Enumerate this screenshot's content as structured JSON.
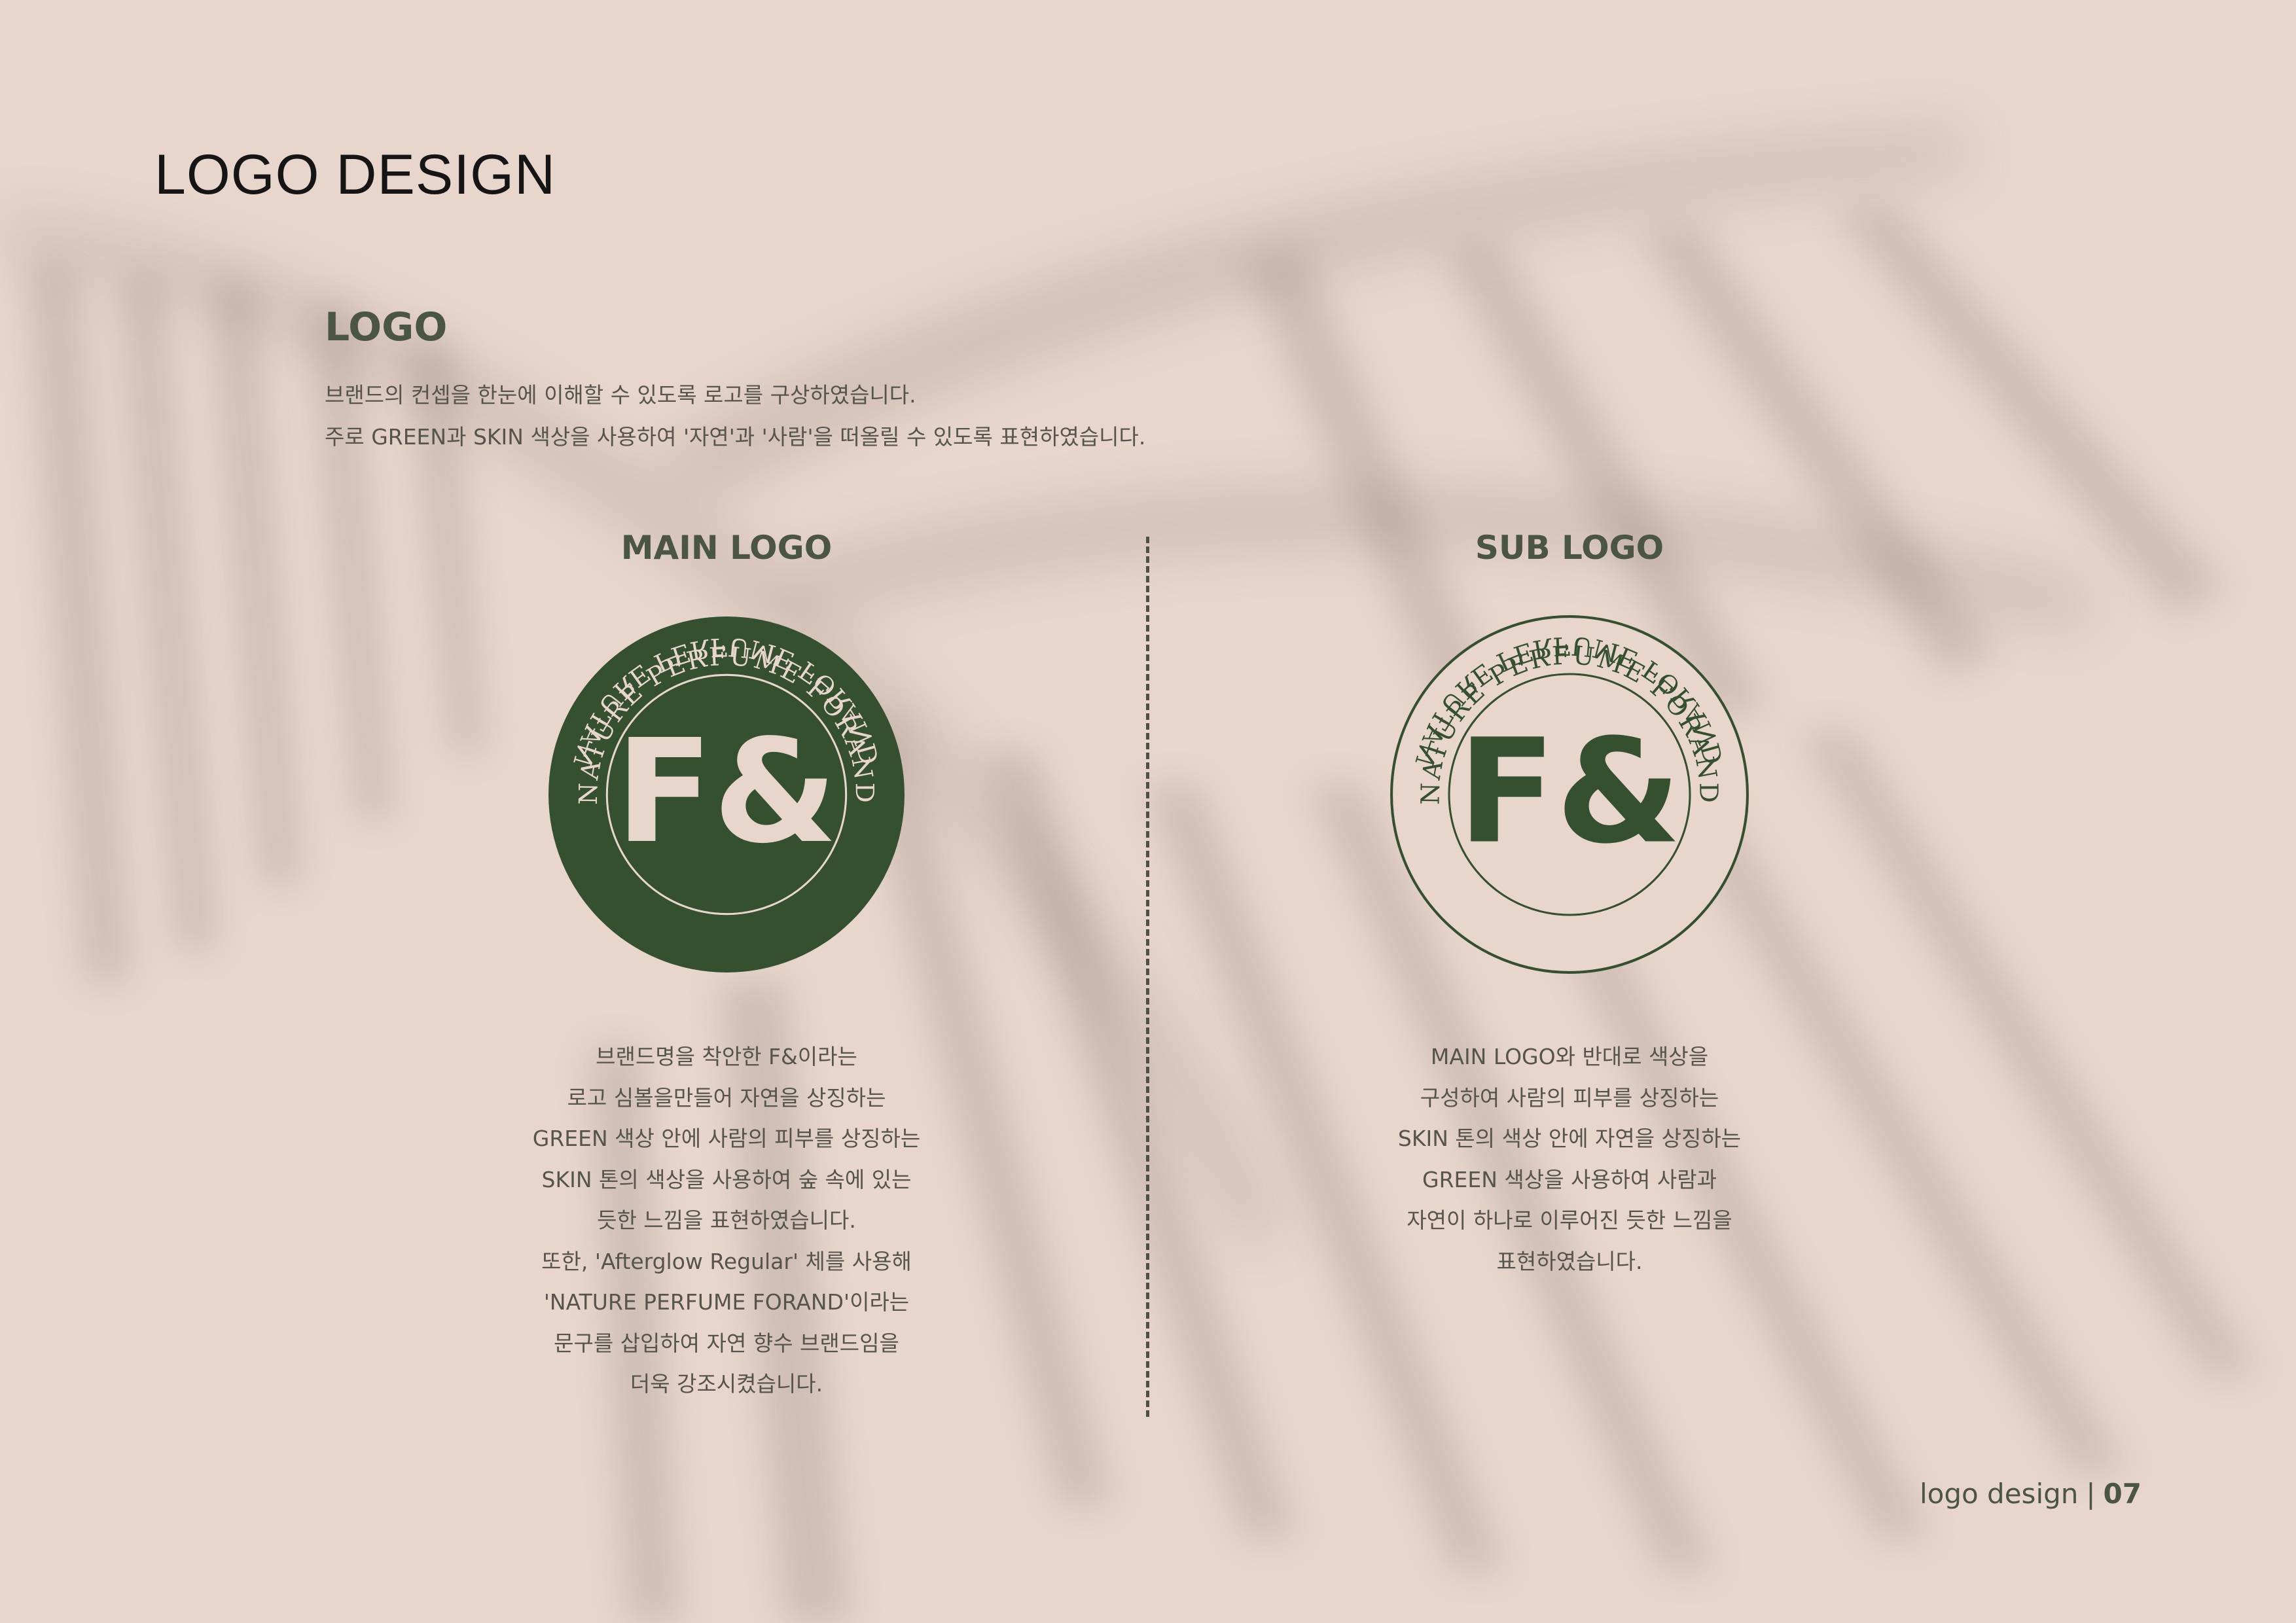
{
  "header": {
    "title": "LOGO DESIGN"
  },
  "logo_section": {
    "title": "LOGO",
    "intro_lines": [
      "브랜드의 컨셉을 한눈에 이해할 수 있도록 로고를 구상하였습니다.",
      "주로 GREEN과 SKIN 색상을 사용하여 '자연'과 '사람'을 떠올릴 수 있도록 표현하였습니다."
    ]
  },
  "main_logo": {
    "title": "MAIN LOGO",
    "mark_text": "F&",
    "ring_text_top": "NATURE PERFUME FORAND",
    "ring_text_bottom": "NATURE PERFUME FORAND",
    "description_lines": [
      "브랜드명을 착안한 F&이라는",
      "로고 심볼을만들어 자연을 상징하는",
      "GREEN 색상 안에 사람의 피부를 상징하는",
      "SKIN 톤의 색상을 사용하여 숲 속에 있는",
      "듯한 느낌을 표현하였습니다.",
      "또한, 'Afterglow Regular' 체를 사용해",
      "'NATURE PERFUME FORAND'이라는",
      "문구를 삽입하여 자연 향수 브랜드임을",
      "더욱 강조시켰습니다."
    ]
  },
  "sub_logo": {
    "title": "SUB LOGO",
    "mark_text": "F&",
    "ring_text_top": "NATURE PERFUME FORAND",
    "ring_text_bottom": "NATURE PERFUME FORAND",
    "description_lines": [
      "MAIN LOGO와 반대로 색상을",
      "구성하여 사람의 피부를 상징하는",
      "SKIN 톤의 색상 안에 자연을 상징하는",
      "GREEN 색상을 사용하여 사람과",
      "자연이 하나로 이루어진 듯한 느낌을",
      "표현하였습니다."
    ]
  },
  "footer": {
    "label": "logo design",
    "separator": "|",
    "page": "07"
  },
  "colors": {
    "background": "#e8d6cd",
    "green": "#35502f",
    "skin": "#e8d6cd",
    "heading": "#4b5543"
  }
}
